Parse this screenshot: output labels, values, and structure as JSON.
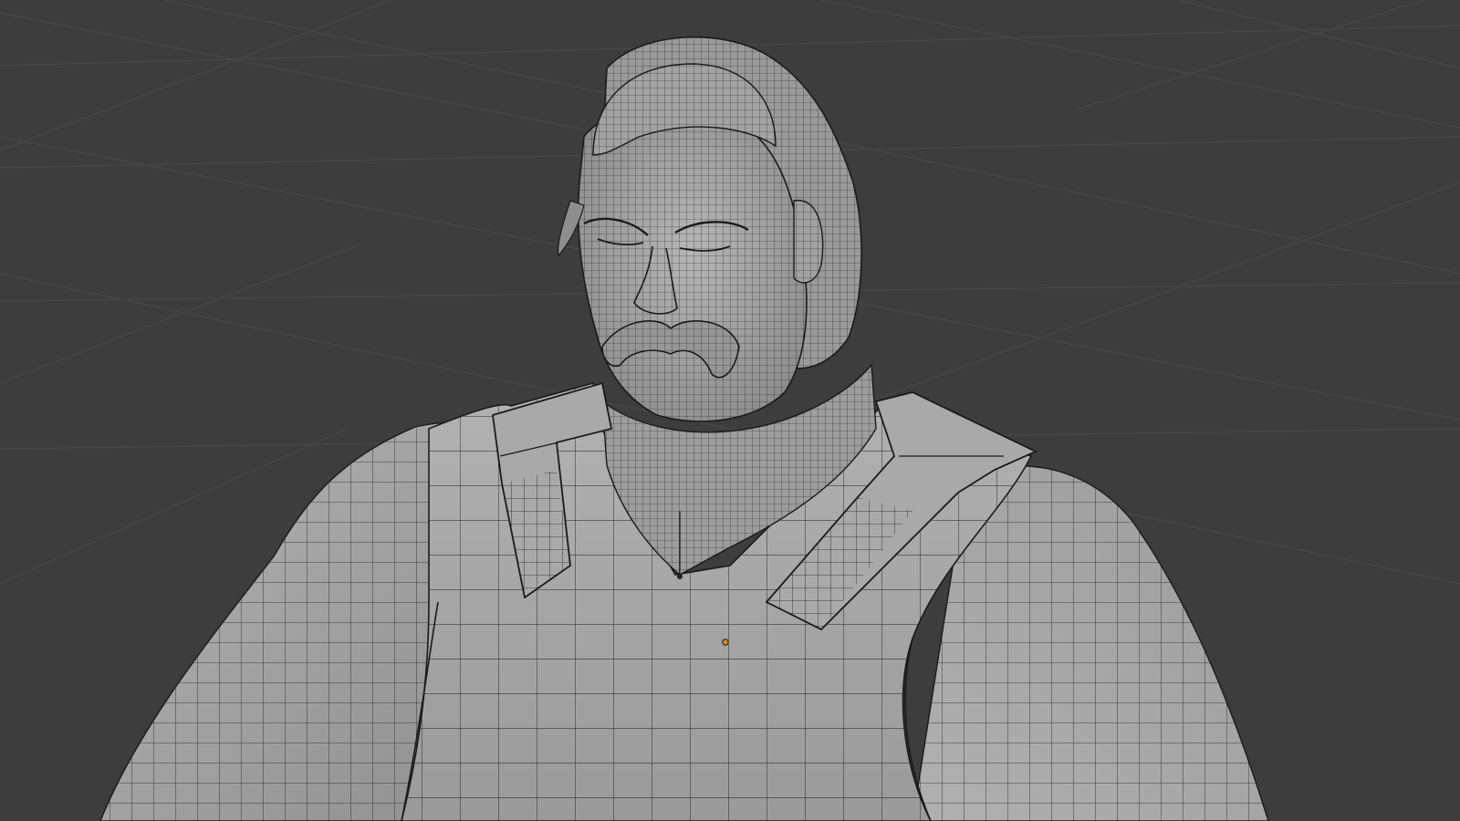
{
  "viewport": {
    "background_color": "#3d3d3d",
    "grid_color": "#474747",
    "mesh_fill_color": "#a4a4a4",
    "wire_color": "#1b1b1b",
    "origin_color": "#e08a1a",
    "shading_mode": "solid-with-wireframe-overlay",
    "subject": "character-bust"
  }
}
